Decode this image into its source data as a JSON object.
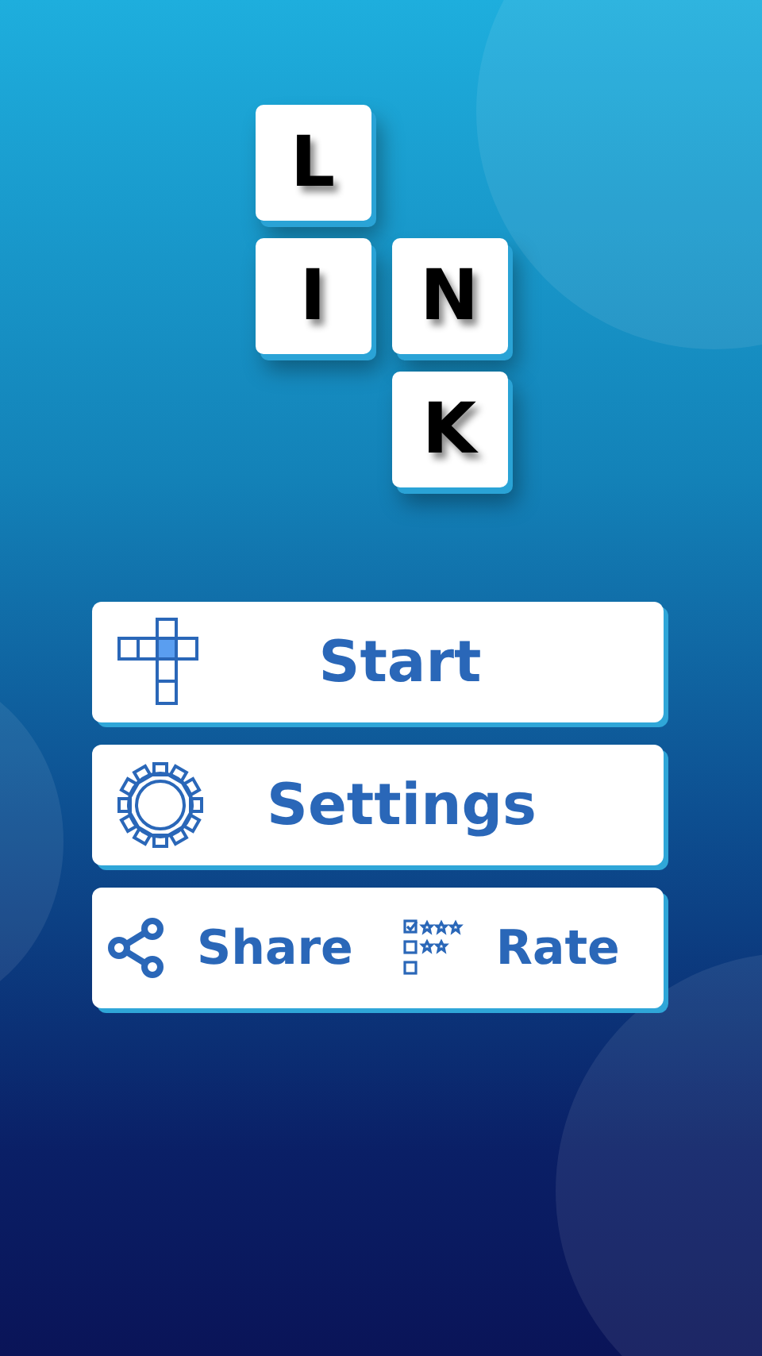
{
  "logo": {
    "tiles": [
      {
        "letter": "L",
        "kind": "left"
      },
      {
        "letter": "I",
        "kind": "left"
      },
      {
        "letter": "N",
        "kind": "right"
      },
      {
        "letter": "K",
        "kind": "right"
      }
    ]
  },
  "menu": [
    {
      "kind": "start",
      "label": "Start"
    },
    {
      "kind": "settings",
      "label": "Settings"
    }
  ],
  "bottom": [
    {
      "kind": "share",
      "label": "Share"
    },
    {
      "kind": "rate",
      "label": "Rate"
    }
  ]
}
